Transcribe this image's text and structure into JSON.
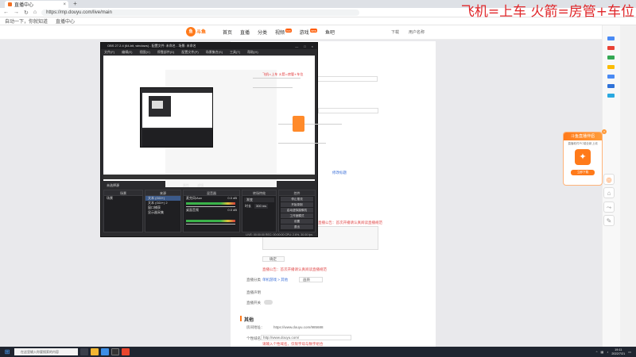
{
  "browser": {
    "tab_title": "直播中心",
    "new_tab": "+",
    "url": "https://mp.douyu.com/live/main",
    "bookmarks": [
      "自动一下，你就知道",
      "直播中心"
    ]
  },
  "overlay_text": "飞机=上车  火箭=房管+车位",
  "site": {
    "logo_text": "斗鱼",
    "nav": [
      "首页",
      "直播",
      "分类",
      "视频",
      "游戏",
      "鱼吧"
    ],
    "nav_badges": {
      "video": "hot",
      "game": "new"
    },
    "right_items": [
      "下载",
      "用户名称"
    ]
  },
  "obs": {
    "title": "OBS 27.2.4 (64-bit, windows) - 配置文件: 未命名 - 场景: 未命名",
    "menu": [
      "文件(F)",
      "编辑(E)",
      "视图(V)",
      "停靠部件(D)",
      "配置文件(P)",
      "场景集合(S)",
      "工具(T)",
      "帮助(H)"
    ],
    "scene_bar": [
      "未选择源",
      "属性",
      "滤镜"
    ],
    "docks": {
      "scenes": {
        "title": "场景",
        "items": [
          "场景"
        ]
      },
      "sources": {
        "title": "来源",
        "items": [
          "文本 (GDI+)",
          "文本 (GDI+) 2",
          "窗口捕获",
          "显示器采集"
        ]
      },
      "mixer": {
        "title": "混音器",
        "tracks": [
          {
            "name": "麦克风/Aux",
            "db": "0.0 dB"
          },
          {
            "name": "桌面音频",
            "db": "0.0 dB"
          }
        ]
      },
      "transitions": {
        "title": "转场特效",
        "mode": "渐变",
        "duration_label": "时长",
        "duration": "300 ms"
      },
      "controls": {
        "title": "控件",
        "buttons": [
          "停止推流",
          "开始录制",
          "启动虚拟摄像机",
          "工作室模式",
          "设置",
          "退出"
        ]
      }
    },
    "status": "LIVE: 00:00:00  REC: 00:00:00  CPU: 2.6%, 30.00 fps"
  },
  "page": {
    "form_lines": [
      {
        "text": "直播标题：",
        "style": "muted"
      },
      {
        "text": "修改标题",
        "style": "link"
      },
      {
        "text": "开播通知",
        "style": "muted"
      },
      {
        "text": "直播公告：首次开播请认真阅读直播规范",
        "style": "red"
      },
      {
        "text": "确定",
        "style": "muted"
      },
      {
        "text": "直播分类",
        "style": "muted"
      },
      {
        "text": "单机游戏 > 其他",
        "style": "link"
      },
      {
        "text": "画质",
        "style": "muted"
      },
      {
        "text": "直播声明",
        "style": "muted"
      },
      {
        "text": "直播开关",
        "style": "muted"
      },
      {
        "text": "其他",
        "style": "heading"
      },
      {
        "text": "房间地址：",
        "style": "muted"
      },
      {
        "text": "https://www.douyu.com/985688",
        "style": "muted"
      },
      {
        "text": "个性域名：",
        "style": "muted"
      },
      {
        "text": "http://www.douyu.com/",
        "style": "muted"
      },
      {
        "text": "请输入个性域名，仅限字母与数字组合",
        "style": "red"
      }
    ]
  },
  "ad": {
    "title": "斗鱼直播伴侣",
    "subtitle": "直播软件PC端全新上线",
    "button": "立即下载",
    "close": "×"
  },
  "taskbar": {
    "search_placeholder": "在这里输入你要搜索的内容",
    "time": "19:11",
    "date": "2022/7/21"
  }
}
